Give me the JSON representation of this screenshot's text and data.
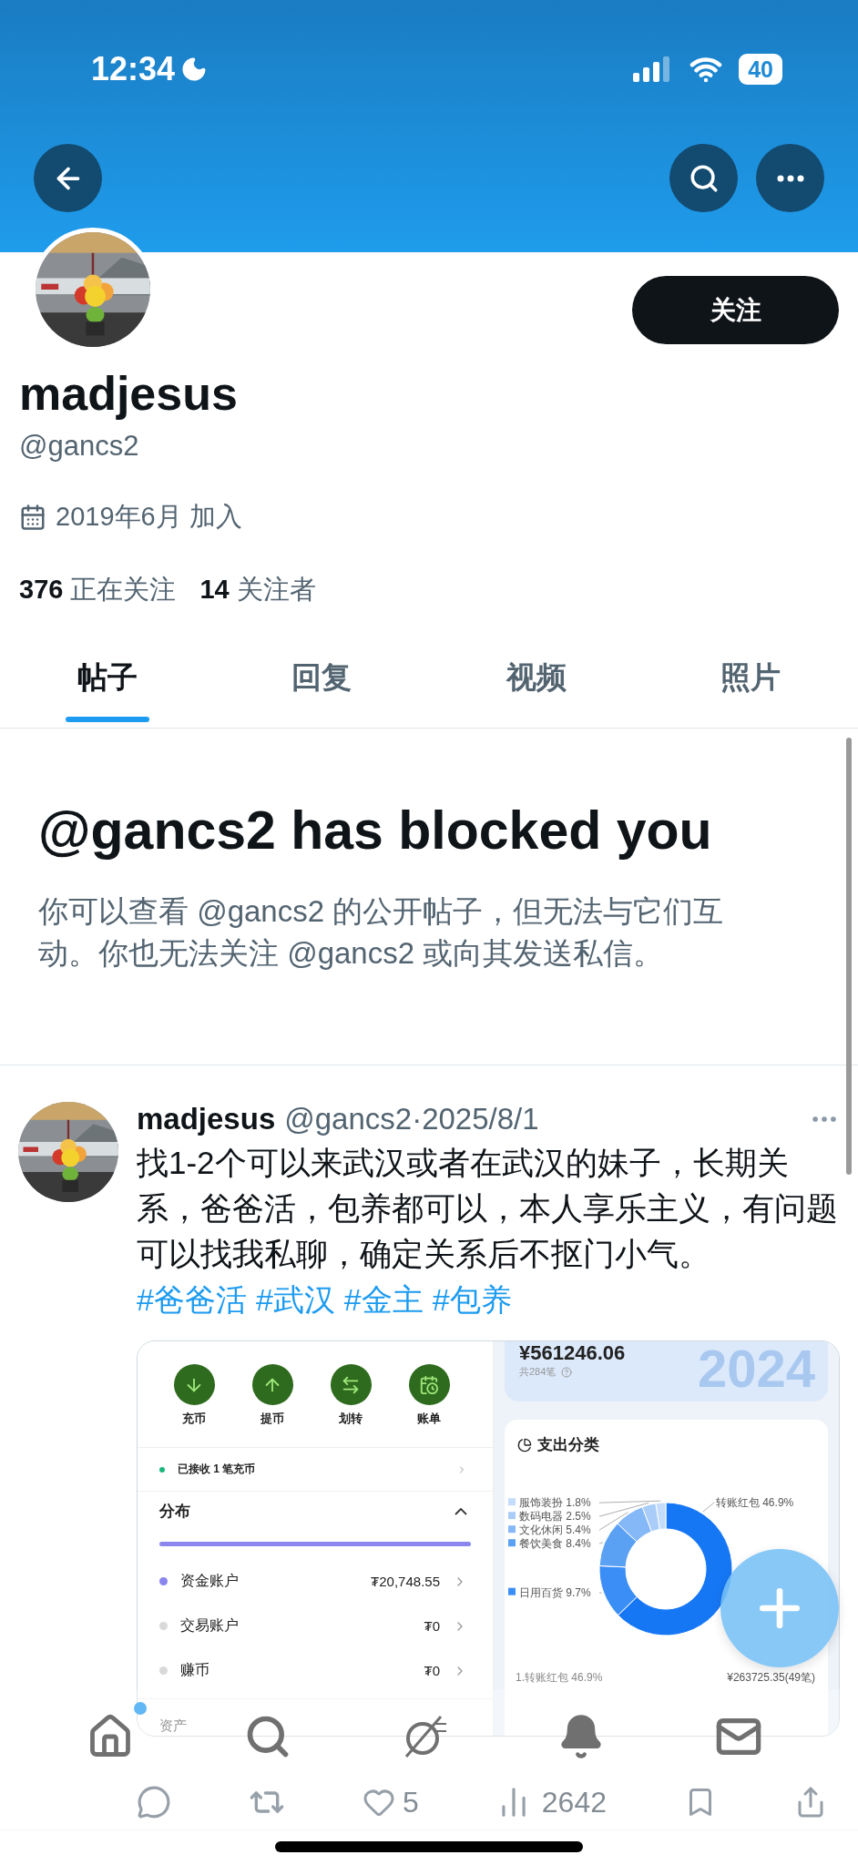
{
  "status_bar": {
    "time": "12:34",
    "battery": "40"
  },
  "profile": {
    "follow_button": "关注",
    "name": "madjesus",
    "handle": "@gancs2",
    "joined": "2019年6月 加入",
    "following_count": "376",
    "following_label": "正在关注",
    "followers_count": "14",
    "followers_label": "关注者"
  },
  "tabs": [
    {
      "label": "帖子",
      "selected": true
    },
    {
      "label": "回复",
      "selected": false
    },
    {
      "label": "视频",
      "selected": false
    },
    {
      "label": "照片",
      "selected": false
    }
  ],
  "blocked_notice": {
    "title": "@gancs2 has blocked you",
    "text": "你可以查看 @gancs2 的公开帖子，但无法与它们互动。你也无法关注 @gancs2 或向其发送私信。"
  },
  "post": {
    "name": "madjesus",
    "meta": "@gancs2·2025/8/1",
    "text": "找1-2个可以来武汉或者在武汉的妹子，长期关系，爸爸活，包养都可以，本人享乐主义，有问题可以找我私聊，确定关系后不抠门小气。",
    "hashtags": [
      "#爸爸活",
      "#武汉",
      "#金主",
      "#包养"
    ],
    "media": {
      "left_panel": {
        "actions": [
          "充币",
          "提币",
          "划转",
          "账单"
        ],
        "notice": "已接收 1 笔充币",
        "section": "分布",
        "distribution_bar": {
          "level": 1
        },
        "accounts": [
          {
            "name": "资金账户",
            "amount": "₮20,748.55",
            "color": "#8a86ee"
          },
          {
            "name": "交易账户",
            "amount": "₮0",
            "color": "#d9d9d9"
          },
          {
            "name": "赚币",
            "amount": "₮0",
            "color": "#d9d9d9"
          }
        ],
        "footer": "资产"
      },
      "right_panel": {
        "total": "¥561246.06",
        "count": "共284笔",
        "year": "2024",
        "title": "支出分类",
        "chart_data": {
          "type": "donut",
          "legend": "left",
          "categories": [
            "转账红包",
            "日用百货",
            "餐饮美食",
            "文化休闲",
            "数码电器",
            "服饰装扮"
          ],
          "values": [
            46.9,
            9.7,
            8.4,
            5.4,
            2.5,
            1.8
          ],
          "value_labels": [
            "46.9%",
            "9.7%",
            "8.4%",
            "5.4%",
            "2.5%",
            "1.8%"
          ]
        },
        "top_item": "1.转账红包 46.9%",
        "top_amount": "¥263725.35(49笔)"
      }
    },
    "likes": "5",
    "views": "2642"
  },
  "bottom_nav": [
    {
      "badge": true
    },
    {
      "badge": false
    },
    {
      "badge": false
    },
    {
      "badge": false
    },
    {
      "badge": false
    }
  ]
}
